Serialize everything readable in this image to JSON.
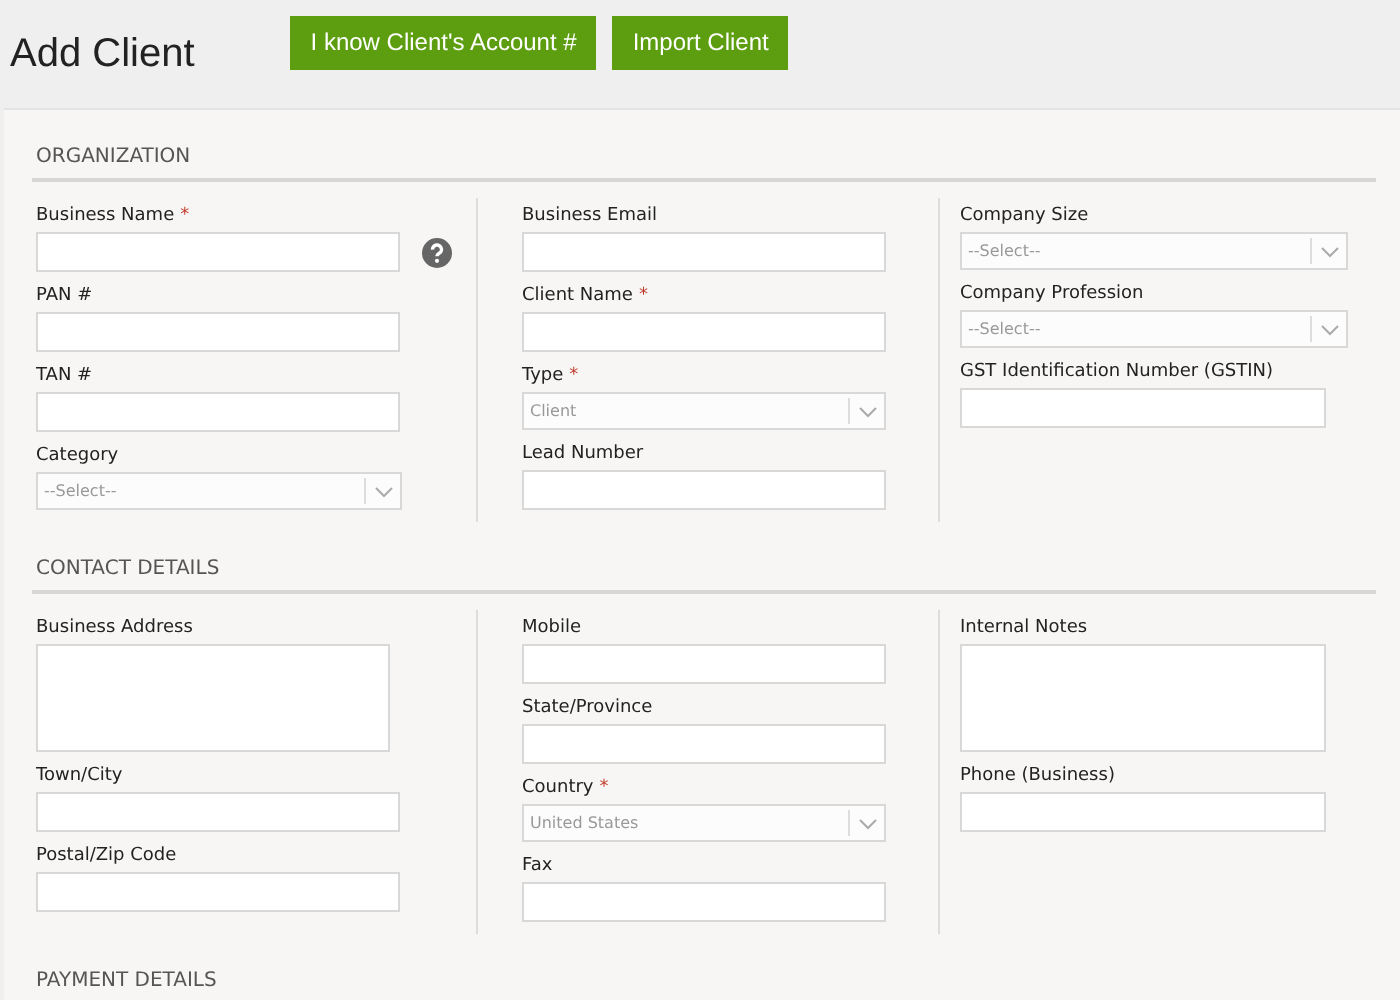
{
  "page_title": "Add Client",
  "buttons": [
    {
      "label": "I know Client's Account #"
    },
    {
      "label": "Import Client"
    }
  ],
  "sections": [
    {
      "title": "ORGANIZATION",
      "columns": [
        [
          {
            "label": "Business Name",
            "required_mark": "*",
            "kind": "text",
            "help": true
          },
          {
            "label": "PAN #",
            "kind": "text"
          },
          {
            "label": "TAN #",
            "kind": "text"
          },
          {
            "label": "Category",
            "kind": "select",
            "value": "--Select--"
          }
        ],
        [
          {
            "label": "Business Email",
            "kind": "text"
          },
          {
            "label": "Client Name",
            "required_mark": "*",
            "kind": "text"
          },
          {
            "label": "Type",
            "required_mark": "*",
            "kind": "select",
            "value": "Client"
          },
          {
            "label": "Lead Number",
            "kind": "text"
          }
        ],
        [
          {
            "label": "Company Size",
            "kind": "select",
            "value": "--Select--"
          },
          {
            "label": "Company Profession",
            "kind": "select",
            "value": "--Select--"
          },
          {
            "label": "GST Identification Number (GSTIN)",
            "kind": "text"
          }
        ]
      ]
    },
    {
      "title": "CONTACT DETAILS",
      "columns": [
        [
          {
            "label": "Business Address",
            "kind": "textarea"
          },
          {
            "label": "Town/City",
            "kind": "text"
          },
          {
            "label": "Postal/Zip Code",
            "kind": "text"
          }
        ],
        [
          {
            "label": "Mobile",
            "kind": "text"
          },
          {
            "label": "State/Province",
            "kind": "text"
          },
          {
            "label": "Country",
            "required_mark": "*",
            "kind": "select",
            "value": "United States"
          },
          {
            "label": "Fax",
            "kind": "text"
          }
        ],
        [
          {
            "label": "Internal Notes",
            "kind": "textarea"
          },
          {
            "label": "Phone (Business)",
            "kind": "text"
          }
        ]
      ]
    },
    {
      "title": "PAYMENT DETAILS"
    }
  ]
}
